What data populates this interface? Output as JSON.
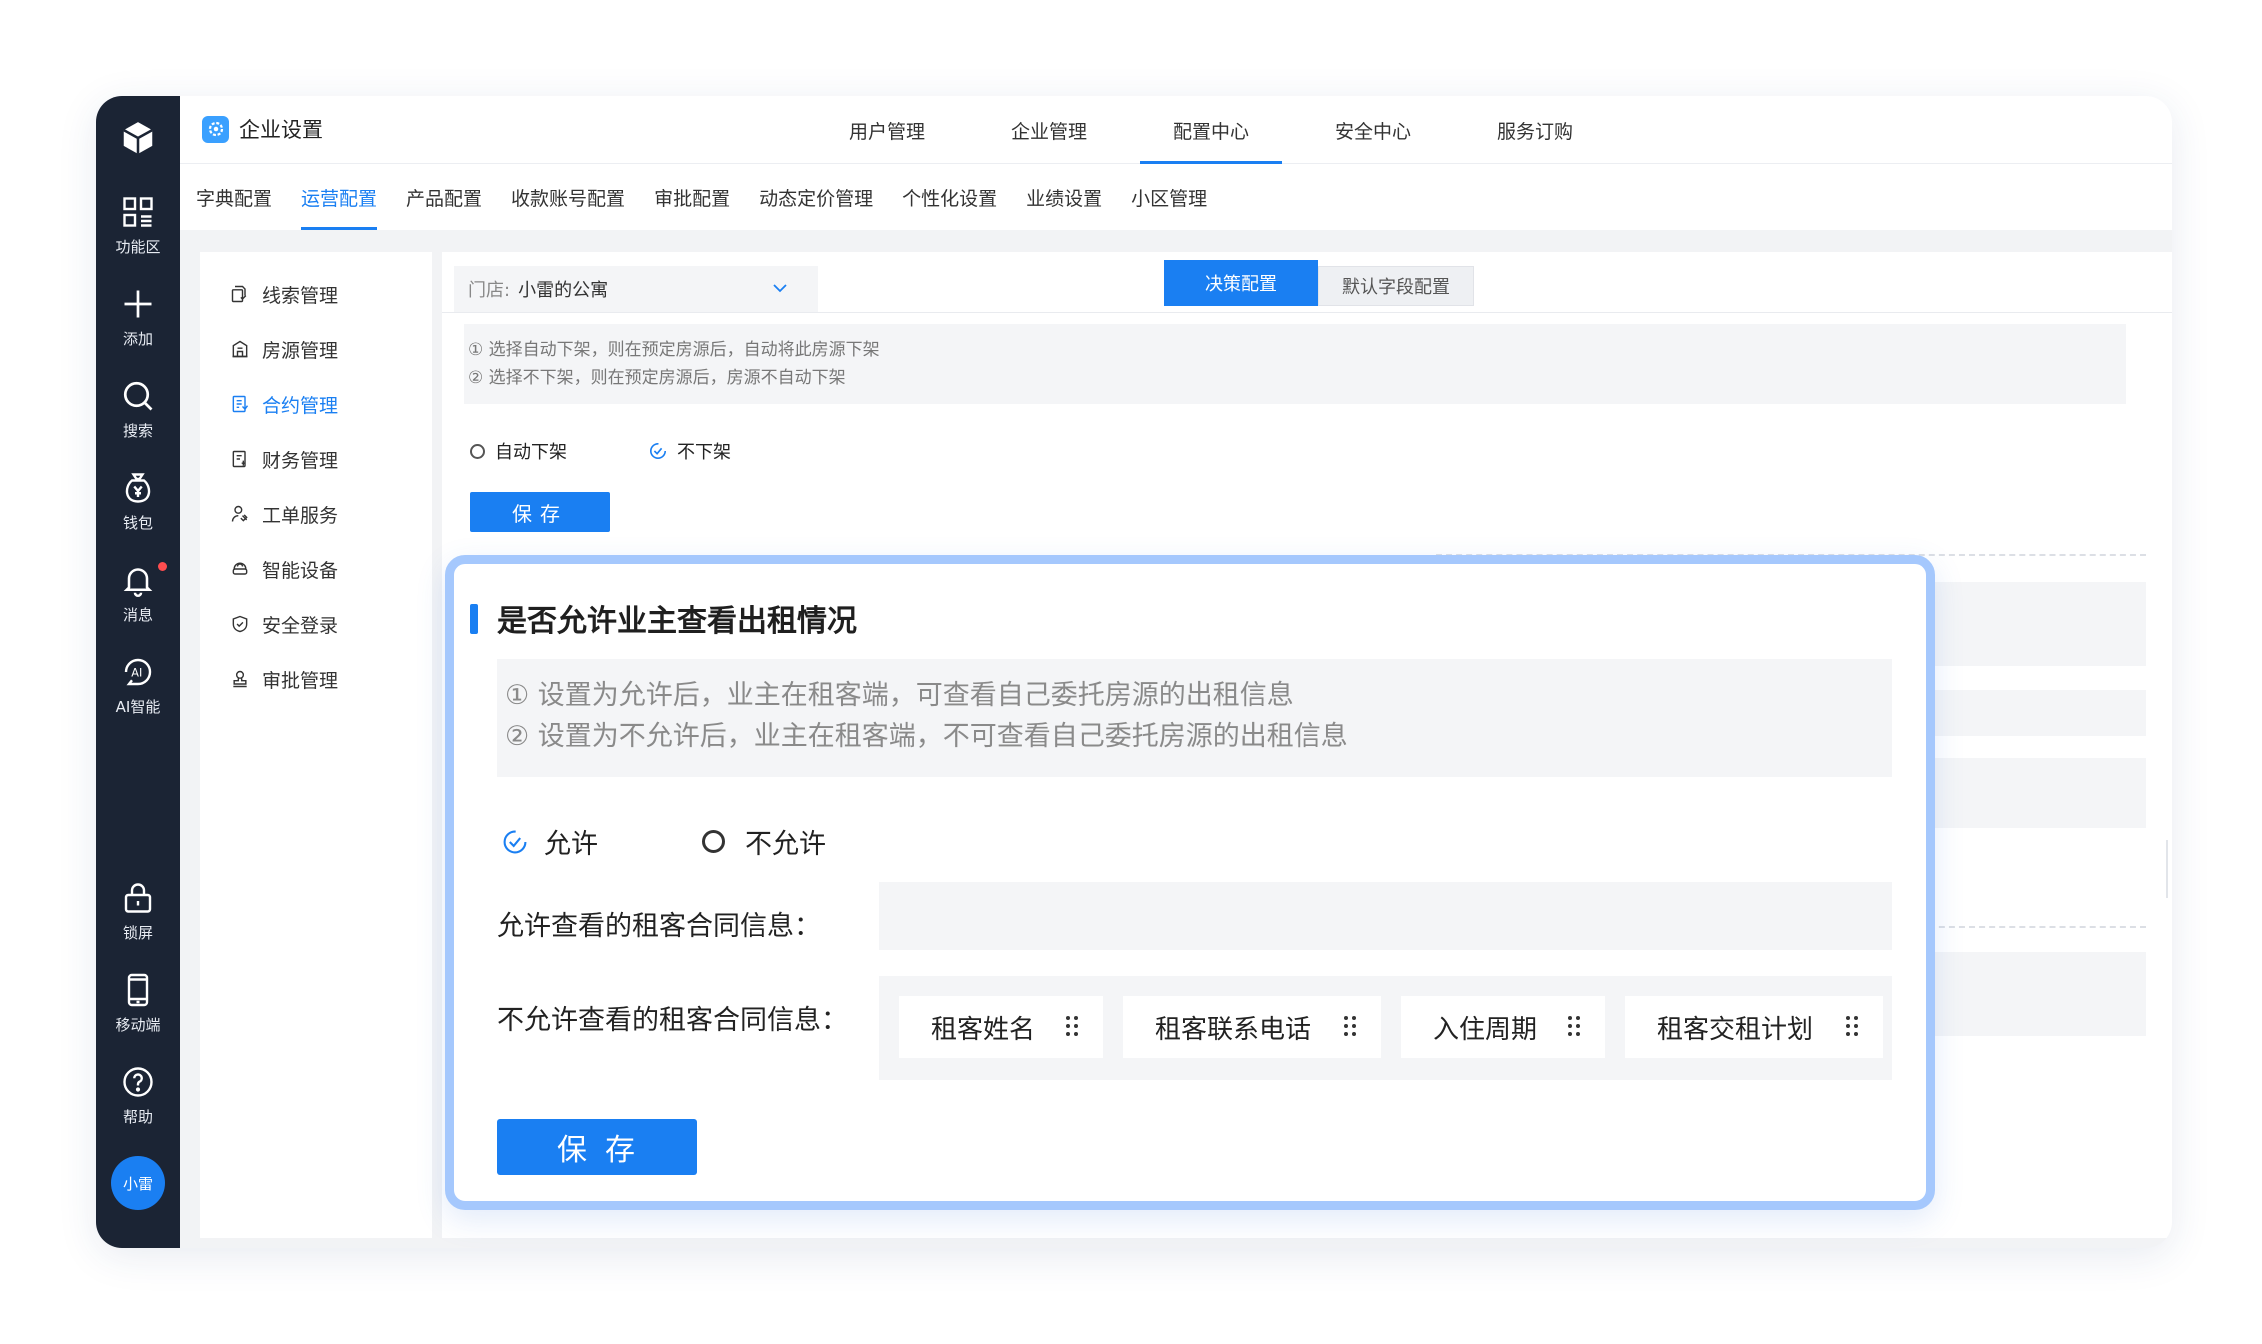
{
  "rail": {
    "items": [
      {
        "label": "功能区",
        "icon": "grid-icon"
      },
      {
        "label": "添加",
        "icon": "plus-icon"
      },
      {
        "label": "搜索",
        "icon": "search-icon"
      },
      {
        "label": "钱包",
        "icon": "wallet-icon"
      },
      {
        "label": "消息",
        "icon": "bell-icon"
      },
      {
        "label": "AI智能",
        "icon": "ai-icon"
      },
      {
        "label": "锁屏",
        "icon": "lock-icon"
      },
      {
        "label": "移动端",
        "icon": "mobile-icon"
      },
      {
        "label": "帮助",
        "icon": "help-icon"
      }
    ],
    "avatar": "小雷"
  },
  "header": {
    "title": "企业设置",
    "tabs": [
      "用户管理",
      "企业管理",
      "配置中心",
      "安全中心",
      "服务订购"
    ],
    "active_tab": "配置中心"
  },
  "subtabs": {
    "items": [
      "字典配置",
      "运营配置",
      "产品配置",
      "收款账号配置",
      "审批配置",
      "动态定价管理",
      "个性化设置",
      "业绩设置",
      "小区管理"
    ],
    "active": "运营配置"
  },
  "menu": {
    "items": [
      "线索管理",
      "房源管理",
      "合约管理",
      "财务管理",
      "工单服务",
      "智能设备",
      "安全登录",
      "审批管理"
    ],
    "active": "合约管理"
  },
  "content": {
    "store_label": "门店:",
    "store_value": "小雷的公寓",
    "seg_on": "决策配置",
    "seg_off": "默认字段配置",
    "hint_line1": "① 选择自动下架，则在预定房源后，自动将此房源下架",
    "hint_line2": "② 选择不下架，则在预定房源后，房源不自动下架",
    "radio_a": "自动下架",
    "radio_b": "不下架",
    "radio_selected": "不下架",
    "save": "保存"
  },
  "zoom": {
    "title": "是否允许业主查看出租情况",
    "hint_line1": "① 设置为允许后，业主在租客端，可查看自己委托房源的出租信息",
    "hint_line2": "② 设置为不允许后，业主在租客端，不可查看自己委托房源的出租信息",
    "radio_allow": "允许",
    "radio_deny": "不允许",
    "radio_selected": "允许",
    "allowed_label": "允许查看的租客合同信息：",
    "denied_label": "不允许查看的租客合同信息：",
    "chips": [
      "租客姓名",
      "租客联系电话",
      "入住周期",
      "租客交租计划"
    ],
    "save": "保存"
  },
  "colors": {
    "primary": "#1a7ff2",
    "rail": "#1b2434",
    "zoom_border": "#a5c8fd"
  }
}
